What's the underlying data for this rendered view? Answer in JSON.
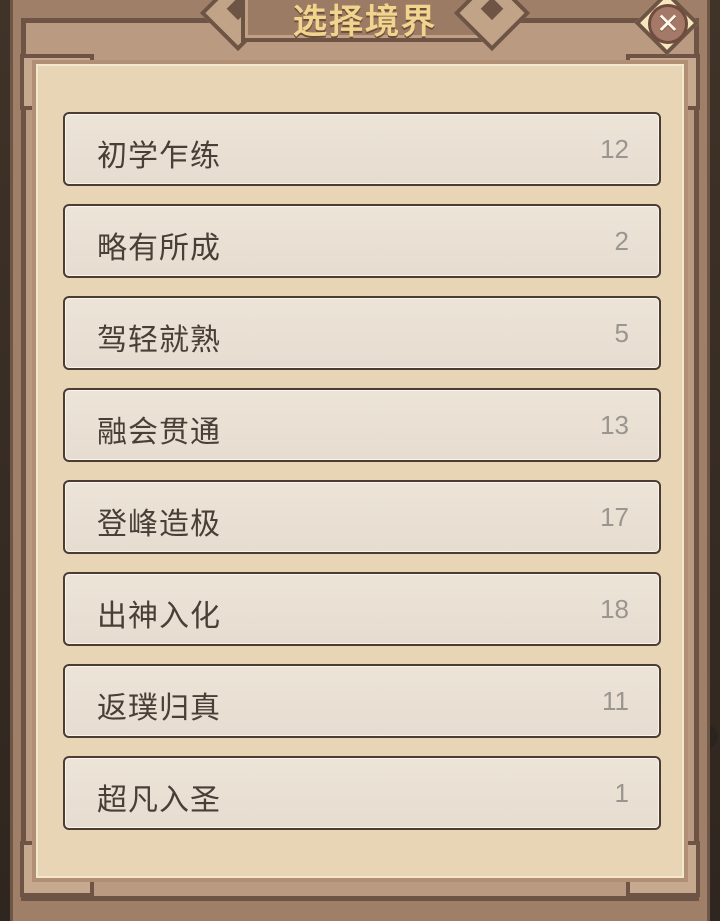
{
  "dialog": {
    "title": "选择境界",
    "close_symbol": "✕"
  },
  "icons": {
    "close": "close-icon",
    "title_left": "lattice-diamond-left-icon",
    "title_right": "lattice-diamond-right-icon"
  },
  "colors": {
    "frame": "#9f7f68",
    "panel": "#e8d5b6",
    "item_bg": "#ede4d8",
    "title_text": "#f1d58f",
    "item_text": "#4a3f37",
    "count_text": "#9b9590"
  },
  "realms": [
    {
      "name": "初学乍练",
      "count": "12"
    },
    {
      "name": "略有所成",
      "count": "2"
    },
    {
      "name": "驾轻就熟",
      "count": "5"
    },
    {
      "name": "融会贯通",
      "count": "13"
    },
    {
      "name": "登峰造极",
      "count": "17"
    },
    {
      "name": "出神入化",
      "count": "18"
    },
    {
      "name": "返璞归真",
      "count": "11"
    },
    {
      "name": "超凡入圣",
      "count": "1"
    }
  ]
}
